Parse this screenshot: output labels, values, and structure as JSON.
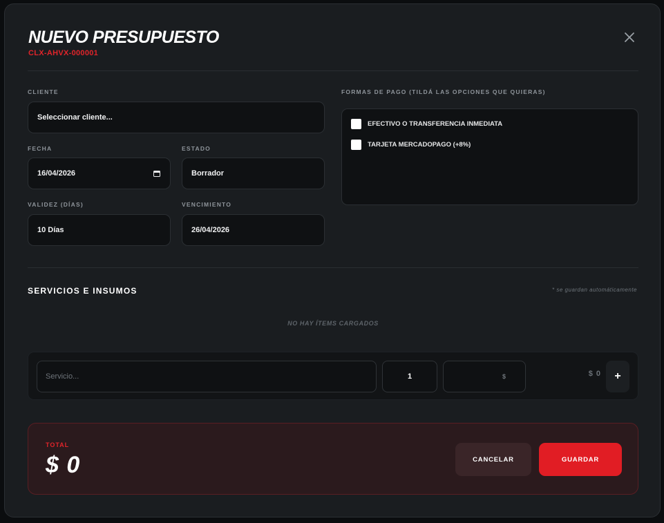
{
  "modal": {
    "title": "NUEVO PRESUPUESTO",
    "code": "CLX-AHVX-000001",
    "close_icon": "close-icon"
  },
  "form": {
    "client": {
      "label": "CLIENTE",
      "value": "Seleccionar cliente..."
    },
    "date": {
      "label": "FECHA",
      "value": "16/04/2026",
      "icon": "calendar-icon"
    },
    "status": {
      "label": "ESTADO",
      "value": "Borrador"
    },
    "validity": {
      "label": "VALIDEZ (DÍAS)",
      "value": "10 Días"
    },
    "expiry": {
      "label": "VENCIMIENTO",
      "value": "26/04/2026"
    }
  },
  "payment": {
    "label": "FORMAS DE PAGO (TILDÁ LAS OPCIONES QUE QUIERAS)",
    "options": [
      {
        "label": "EFECTIVO O TRANSFERENCIA INMEDIATA",
        "checked": false
      },
      {
        "label": "TARJETA MERCADOPAGO (+8%)",
        "checked": false
      }
    ]
  },
  "services": {
    "title": "SERVICIOS E INSUMOS",
    "auto_note": "* se guardan automáticamente",
    "empty_text": "NO HAY ÍTEMS CARGADOS",
    "new_item": {
      "service_placeholder": "Servicio...",
      "quantity": "1",
      "price_placeholder": "$",
      "row_total": "$ 0",
      "add_label": "+"
    }
  },
  "footer": {
    "total_label": "TOTAL",
    "total_value": "$ 0",
    "cancel_label": "CANCELAR",
    "save_label": "GUARDAR"
  },
  "colors": {
    "accent": "#e11d24",
    "background": "#1a1d20",
    "field": "#0f1113"
  }
}
